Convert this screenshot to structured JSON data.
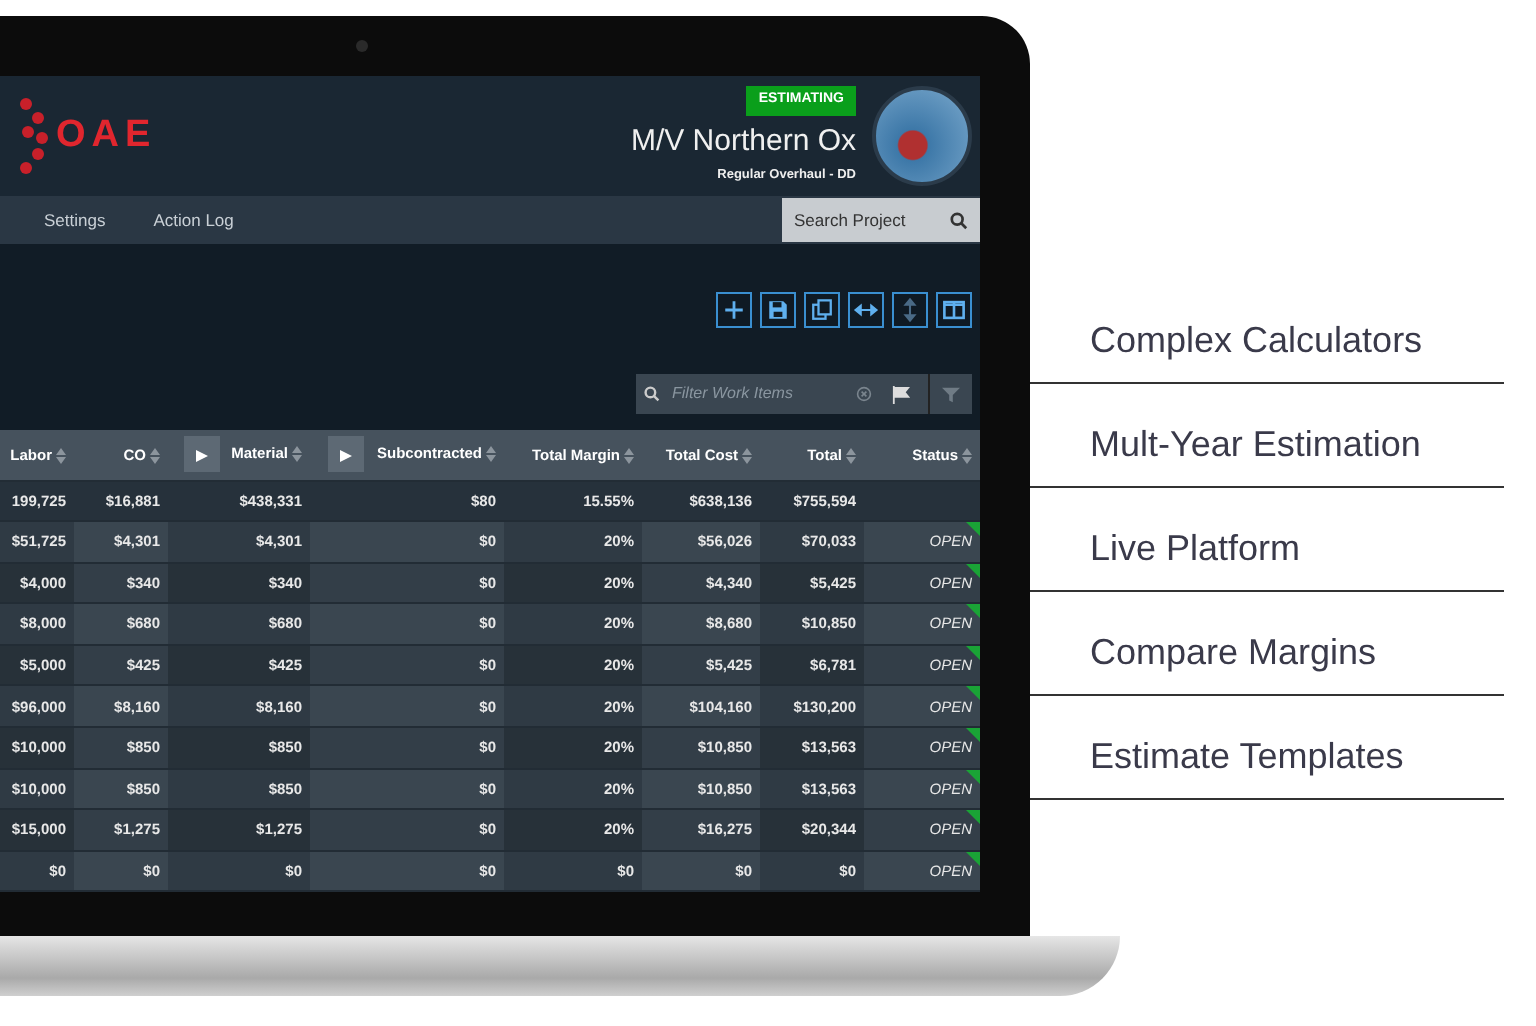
{
  "header": {
    "logo_text": "OAE",
    "status_badge": "ESTIMATING",
    "title": "M/V Northern Ox",
    "subtitle": "Regular Overhaul - DD"
  },
  "nav": {
    "items": [
      "Settings",
      "Action Log"
    ],
    "search_button": "Search Project"
  },
  "filter": {
    "placeholder": "Filter Work Items"
  },
  "table": {
    "columns": [
      {
        "label": "Labor",
        "expandable": false
      },
      {
        "label": "CO",
        "expandable": false
      },
      {
        "label": "Material",
        "expandable": true
      },
      {
        "label": "Subcontracted",
        "expandable": true
      },
      {
        "label": "Total Margin",
        "expandable": false
      },
      {
        "label": "Total Cost",
        "expandable": false
      },
      {
        "label": "Total",
        "expandable": false
      },
      {
        "label": "Status",
        "expandable": false
      }
    ],
    "totals": [
      "199,725",
      "$16,881",
      "$438,331",
      "$80",
      "15.55%",
      "$638,136",
      "$755,594"
    ],
    "rows": [
      [
        "$51,725",
        "$4,301",
        "$4,301",
        "$0",
        "20%",
        "$56,026",
        "$70,033",
        "OPEN"
      ],
      [
        "$4,000",
        "$340",
        "$340",
        "$0",
        "20%",
        "$4,340",
        "$5,425",
        "OPEN"
      ],
      [
        "$8,000",
        "$680",
        "$680",
        "$0",
        "20%",
        "$8,680",
        "$10,850",
        "OPEN"
      ],
      [
        "$5,000",
        "$425",
        "$425",
        "$0",
        "20%",
        "$5,425",
        "$6,781",
        "OPEN"
      ],
      [
        "$96,000",
        "$8,160",
        "$8,160",
        "$0",
        "20%",
        "$104,160",
        "$130,200",
        "OPEN"
      ],
      [
        "$10,000",
        "$850",
        "$850",
        "$0",
        "20%",
        "$10,850",
        "$13,563",
        "OPEN"
      ],
      [
        "$10,000",
        "$850",
        "$850",
        "$0",
        "20%",
        "$10,850",
        "$13,563",
        "OPEN"
      ],
      [
        "$15,000",
        "$1,275",
        "$1,275",
        "$0",
        "20%",
        "$16,275",
        "$20,344",
        "OPEN"
      ],
      [
        "$0",
        "$0",
        "$0",
        "$0",
        "$0",
        "$0",
        "$0",
        "OPEN"
      ]
    ]
  },
  "features": [
    "Complex Calculators",
    "Mult-Year Estimation",
    "Live Platform",
    "Compare Margins",
    "Estimate Templates"
  ]
}
